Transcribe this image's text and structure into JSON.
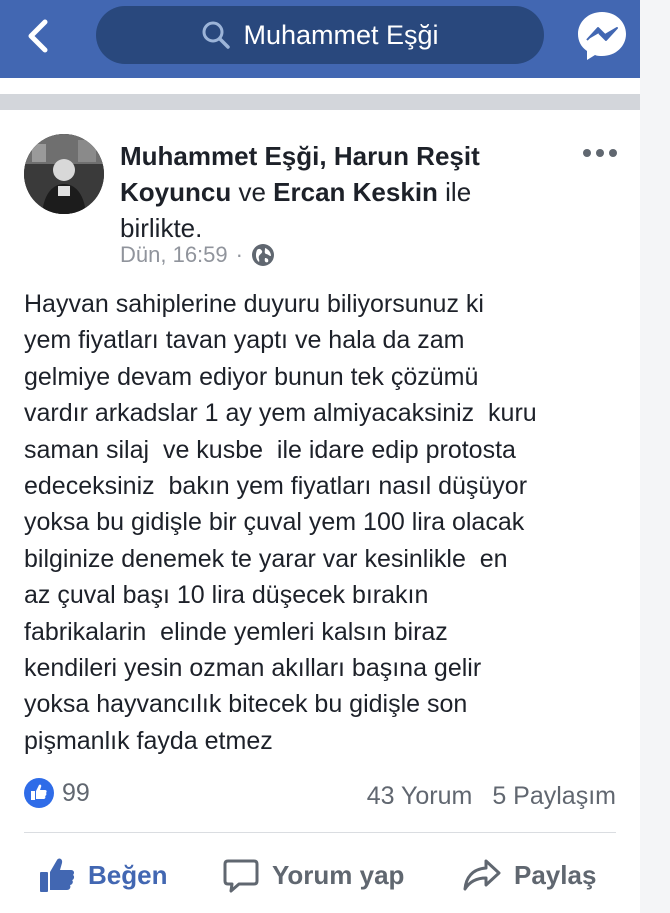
{
  "topbar": {
    "search_text": "Muhammet Eşği",
    "colors": {
      "bar": "#4267b2",
      "search_bg": "#29487d"
    },
    "icons": {
      "back": "chevron-left-icon",
      "search": "search-icon",
      "messenger": "messenger-icon"
    }
  },
  "post": {
    "author_primary": "Muhammet Eşği,",
    "author_secondary": "Harun Reşit Koyuncu",
    "connector": "ve",
    "author_tertiary": "Ercan Keskin",
    "suffix": "ile birlikte.",
    "timestamp": "Dün, 16:59",
    "separator_dot": "·",
    "audience_icon": "globe-icon",
    "body_lines": [
      "Hayvan sahiplerine duyuru biliyorsunuz ki",
      "yem fiyatları tavan yaptı ve hala da zam",
      "gelmiye devam ediyor bunun tek çözümü",
      "vardır arkadslar 1 ay yem almiyacaksiniz  kuru",
      "saman silaj  ve kusbe  ile idare edip protosta",
      "edeceksiniz  bakın yem fiyatları nasıl düşüyor",
      "yoksa bu gidişle bir çuval yem 100 lira olacak",
      "bilginize denemek te yarar var kesinlikle  en",
      "az çuval başı 10 lira düşecek bırakın",
      "fabrikalarin  elinde yemleri kalsın biraz",
      "kendileri yesin ozman akılları başına gelir",
      "yoksa hayvancılık bitecek bu gidişle son",
      "pişmanlık fayda etmez"
    ],
    "stats": {
      "likes": "99",
      "comments": "43 Yorum",
      "shares": "5 Paylaşım"
    },
    "actions": {
      "like": "Beğen",
      "comment": "Yorum yap",
      "share": "Paylaş"
    }
  }
}
